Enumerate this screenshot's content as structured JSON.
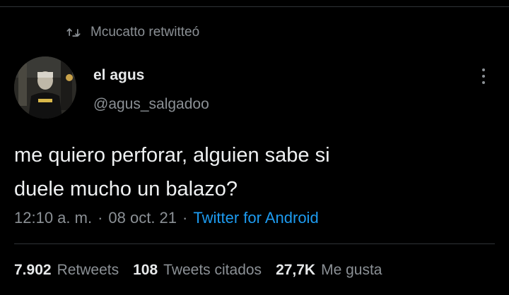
{
  "retweet_banner": {
    "icon": "retweet-icon",
    "text": "Mcucatto retwitteó"
  },
  "author": {
    "name": "el agus",
    "handle": "@agus_salgadoo",
    "avatar": "profile-photo"
  },
  "tweet": {
    "line1": "me quiero perforar, alguien sabe si",
    "line2": "duele mucho un balazo?"
  },
  "meta": {
    "time": "12:10 a. m.",
    "sep1": "·",
    "date": "08 oct. 21",
    "sep2": "·",
    "source": "Twitter for Android"
  },
  "stats": [
    {
      "count": "7.902",
      "label": "Retweets"
    },
    {
      "count": "108",
      "label": "Tweets citados"
    },
    {
      "count": "27,7K",
      "label": "Me gusta"
    }
  ],
  "colors": {
    "background": "#000000",
    "text": "#e7e9ea",
    "secondary": "#8b9095",
    "link": "#1d9bf0",
    "divider": "#2f3336"
  }
}
